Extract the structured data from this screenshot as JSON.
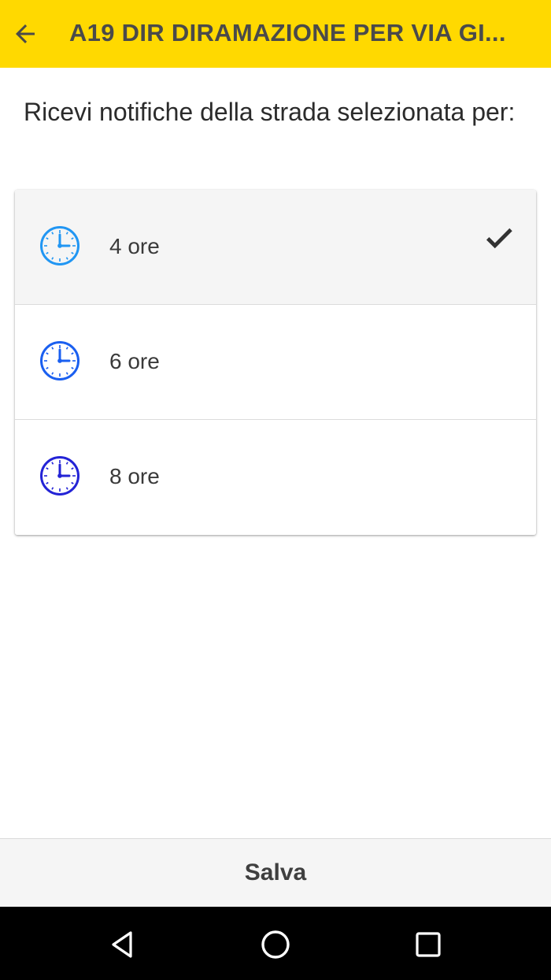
{
  "appbar": {
    "title": "A19 DIR DIRAMAZIONE PER VIA GI...",
    "back_icon": "arrow-left-icon",
    "background_color": "#ffd900"
  },
  "prompt": {
    "text": "Ricevi notifiche della strada selezionata per:"
  },
  "options": [
    {
      "label": "4 ore",
      "icon": "clock-icon",
      "icon_color": "#2196f3",
      "selected": true
    },
    {
      "label": "6 ore",
      "icon": "clock-icon",
      "icon_color": "#1a5ff0",
      "selected": false
    },
    {
      "label": "8 ore",
      "icon": "clock-icon",
      "icon_color": "#2323d6",
      "selected": false
    }
  ],
  "selected_indicator_icon": "checkmark-icon",
  "savebar": {
    "label": "Salva"
  },
  "navbar": {
    "back_icon": "triangle-back-icon",
    "home_icon": "circle-home-icon",
    "recents_icon": "square-recents-icon"
  }
}
